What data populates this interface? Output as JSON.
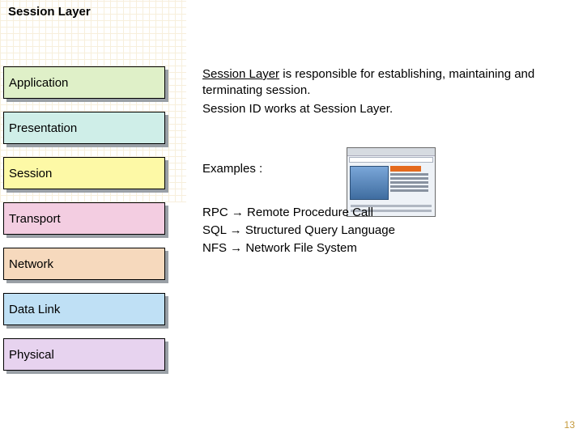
{
  "title": "Session Layer",
  "layers": [
    {
      "label": "Application",
      "cls": "b-app"
    },
    {
      "label": "Presentation",
      "cls": "b-pres"
    },
    {
      "label": "Session",
      "cls": "b-sess"
    },
    {
      "label": "Transport",
      "cls": "b-tran"
    },
    {
      "label": "Network",
      "cls": "b-net"
    },
    {
      "label": "Data Link",
      "cls": "b-dl"
    },
    {
      "label": "Physical",
      "cls": "b-phy"
    }
  ],
  "intro": {
    "subject": "Session Layer",
    "line1_rest": " is responsible for establishing, maintaining and terminating session.",
    "line2": "Session ID works at Session Layer."
  },
  "examples_label": "Examples :",
  "examples": [
    {
      "abbr": "RPC",
      "full": "Remote Procedure Call"
    },
    {
      "abbr": "SQL",
      "full": "Structured Query Language"
    },
    {
      "abbr": "NFS",
      "full": "Network File System"
    }
  ],
  "arrow_glyph": "→",
  "page_number": "13"
}
